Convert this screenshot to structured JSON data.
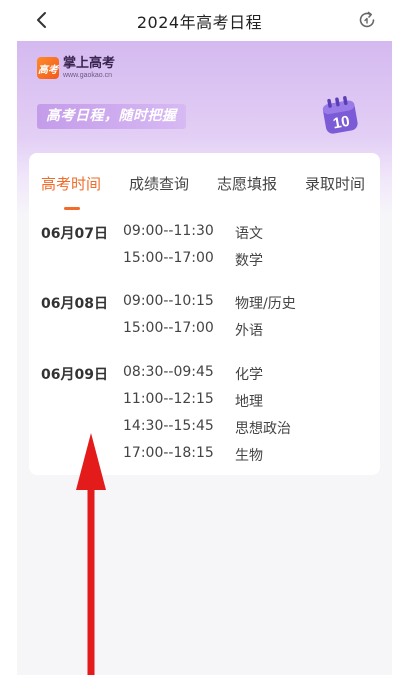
{
  "nav": {
    "title": "2024年高考日程",
    "back_icon": "chevron-left-icon",
    "refresh_icon": "refresh-icon"
  },
  "banner": {
    "logo_badge": "高考",
    "logo_name": "掌上高考",
    "logo_url": "www.gaokao.cn",
    "slogan": "高考日程，随时把握",
    "calendar_day": "10",
    "calendar_icon": "calendar-icon"
  },
  "tabs": [
    {
      "label": "高考时间",
      "active": true
    },
    {
      "label": "成绩查询",
      "active": false
    },
    {
      "label": "志愿填报",
      "active": false
    },
    {
      "label": "录取时间",
      "active": false
    }
  ],
  "schedule": [
    {
      "date": "06月07日",
      "sessions": [
        {
          "time": "09:00--11:30",
          "subject": "语文"
        },
        {
          "time": "15:00--17:00",
          "subject": "数学"
        }
      ]
    },
    {
      "date": "06月08日",
      "sessions": [
        {
          "time": "09:00--10:15",
          "subject": "物理/历史"
        },
        {
          "time": "15:00--17:00",
          "subject": "外语"
        }
      ]
    },
    {
      "date": "06月09日",
      "sessions": [
        {
          "time": "08:30--09:45",
          "subject": "化学"
        },
        {
          "time": "11:00--12:15",
          "subject": "地理"
        },
        {
          "time": "14:30--15:45",
          "subject": "思想政治"
        },
        {
          "time": "17:00--18:15",
          "subject": "生物"
        }
      ]
    }
  ],
  "colors": {
    "accent": "#f26b2a",
    "banner_purple": "#d4b9f0",
    "arrow_red": "#e31b1b"
  }
}
